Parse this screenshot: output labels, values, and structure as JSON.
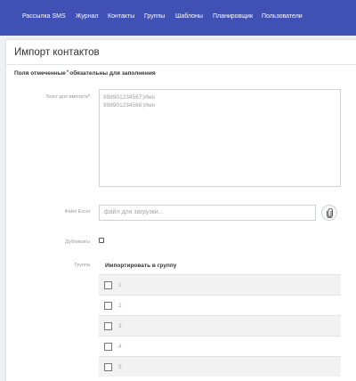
{
  "nav": {
    "items": [
      "Рассылка SMS",
      "Журнал",
      "Контакты",
      "Группы",
      "Шаблоны",
      "Планировщик",
      "Пользователи"
    ]
  },
  "page": {
    "title": "Импорт контактов",
    "required_note_prefix": "Поля отмеченные",
    "required_note_star": "*",
    "required_note_suffix": "обязательны для заполнения"
  },
  "form": {
    "text_label": "Текст для импорта",
    "text_required_star": "*",
    "text_value": "998901234567;Имя\n998901234568;Имя",
    "file_label": "Файл Excel",
    "file_placeholder": "файл для загрузки...",
    "duplicates_label": "Дубликаты",
    "groups_label": "Группа",
    "groups_header": "Импортировать в группу",
    "groups": [
      "1",
      "2",
      "3",
      "4",
      "5"
    ]
  },
  "colors": {
    "nav_bg": "#3f51b5",
    "required_star": "#e53935"
  },
  "icons": {
    "attach": "paperclip-icon"
  }
}
